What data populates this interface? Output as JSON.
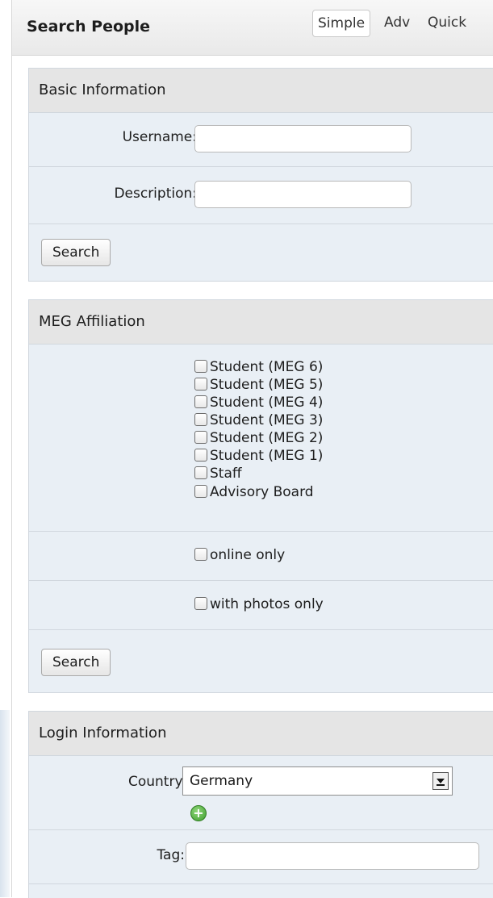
{
  "header": {
    "title": "Search People",
    "tabs": [
      "Simple",
      "Adv",
      "Quick"
    ],
    "active_tab": "Simple"
  },
  "basic_information": {
    "heading": "Basic Information",
    "username_label": "Username:",
    "username_value": "",
    "description_label": "Description:",
    "description_value": "",
    "search_button": "Search"
  },
  "affiliation": {
    "heading": "MEG Affiliation",
    "options": [
      {
        "label": "Student (MEG 6)",
        "checked": false
      },
      {
        "label": "Student (MEG 5)",
        "checked": false
      },
      {
        "label": "Student (MEG 4)",
        "checked": false
      },
      {
        "label": "Student (MEG 3)",
        "checked": false
      },
      {
        "label": "Student (MEG 2)",
        "checked": false
      },
      {
        "label": "Student (MEG 1)",
        "checked": false
      },
      {
        "label": "Staff",
        "checked": false
      },
      {
        "label": "Advisory Board",
        "checked": false
      }
    ],
    "online_only": "online only",
    "with_photos_only": "with photos only",
    "search_button": "Search"
  },
  "login_information": {
    "heading": "Login Information",
    "country_label": "Country:",
    "country_value": "Germany",
    "add_icon": "add-circle-icon",
    "tag_label": "Tag:",
    "tag_value": ""
  }
}
